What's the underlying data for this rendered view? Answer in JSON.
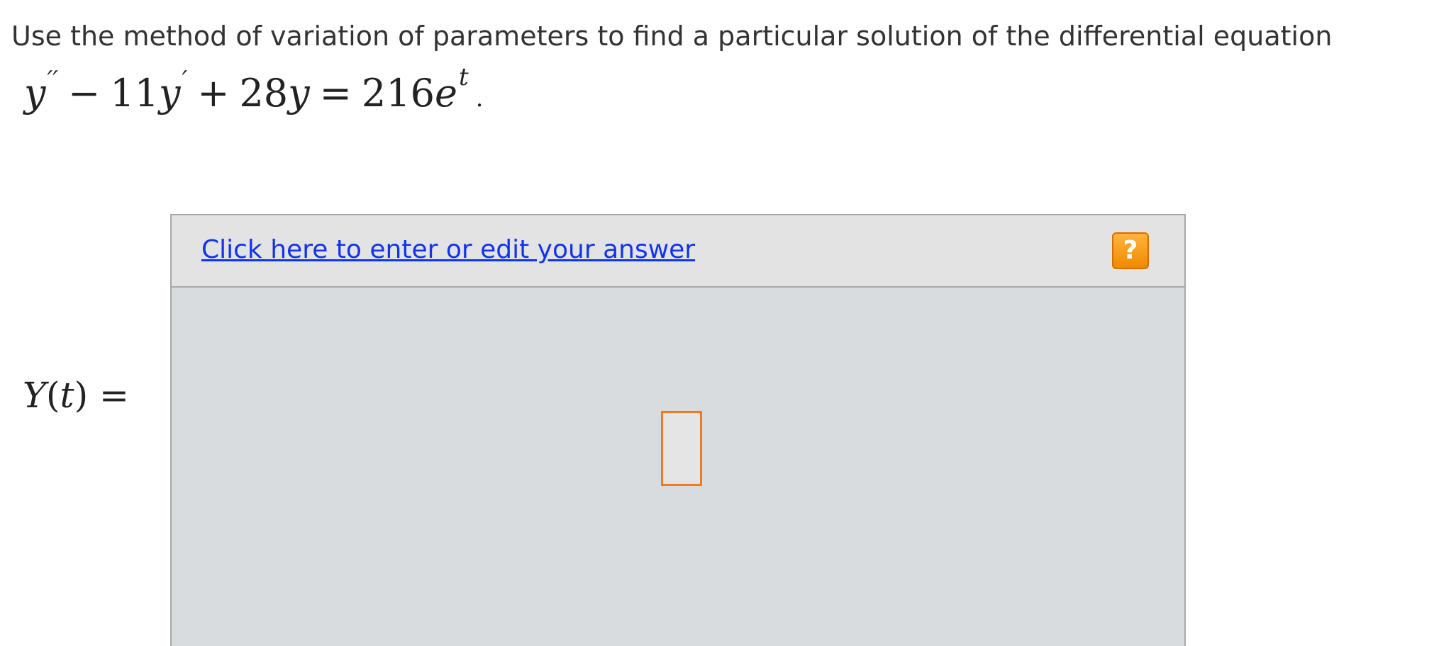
{
  "question": {
    "prompt": "Use the method of variation of parameters to find a particular solution of the differential equation",
    "equation": {
      "y1": "y",
      "prime2": "′′",
      "minus": "−",
      "coef1": "11",
      "y2": "y",
      "prime1": "′",
      "plus": "+",
      "coef2": "28",
      "y3": "y",
      "equals": "=",
      "rhs_coef": "216",
      "rhs_base": "e",
      "rhs_exp": "t",
      "end": "."
    }
  },
  "answer": {
    "label_func": "Y",
    "label_open": "(",
    "label_var": "t",
    "label_close": ")",
    "label_equals": " =",
    "link_text": "Click here to enter or edit your answer",
    "help_label": "?",
    "input_value": ""
  },
  "colors": {
    "link": "#1133ee",
    "help_button": "#f08a00",
    "input_border": "#ef7a22",
    "answer_area_bg": "#d9dcdf"
  },
  "icons": {
    "help": "help-question-icon"
  }
}
